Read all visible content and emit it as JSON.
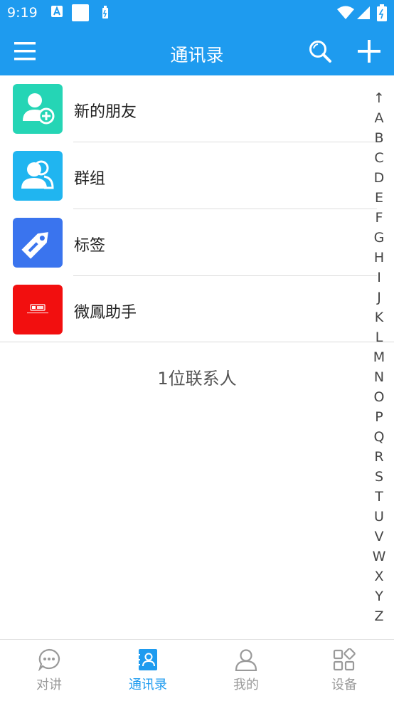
{
  "status_bar": {
    "time": "9:19"
  },
  "app_bar": {
    "title": "通讯录"
  },
  "list_items": [
    {
      "label": "新的朋友",
      "icon": "new-friend-icon",
      "color": "#25D5B5"
    },
    {
      "label": "群组",
      "icon": "group-icon",
      "color": "#20B5F0"
    },
    {
      "label": "标签",
      "icon": "tag-icon",
      "color": "#3A74EE"
    },
    {
      "label": "微鳳助手",
      "icon": "assistant-logo-icon",
      "color": "#F20F0F"
    }
  ],
  "contact_count": "1位联系人",
  "index_bar": [
    "↑",
    "A",
    "B",
    "C",
    "D",
    "E",
    "F",
    "G",
    "H",
    "I",
    "J",
    "K",
    "L",
    "M",
    "N",
    "O",
    "P",
    "Q",
    "R",
    "S",
    "T",
    "U",
    "V",
    "W",
    "X",
    "Y",
    "Z"
  ],
  "tabs": [
    {
      "label": "对讲",
      "icon": "chat-icon",
      "active": false
    },
    {
      "label": "通讯录",
      "icon": "contacts-icon",
      "active": true
    },
    {
      "label": "我的",
      "icon": "profile-icon",
      "active": false
    },
    {
      "label": "设备",
      "icon": "devices-icon",
      "active": false
    }
  ],
  "colors": {
    "primary": "#1E9BEF",
    "inactive": "#9A9A9A"
  }
}
